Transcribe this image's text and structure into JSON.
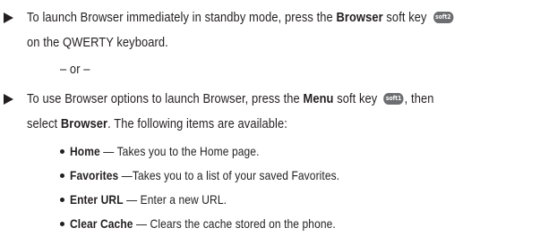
{
  "step1": {
    "text_before": "To launch Browser immediately in standby mode, press the ",
    "bold": "Browser",
    "text_after": " soft key ",
    "icon_label": "soft2",
    "line2": "on the QWERTY keyboard."
  },
  "or_text": "– or –",
  "step2": {
    "text_before": "To use Browser options to launch Browser, press the ",
    "bold": "Menu",
    "text_after": " soft key ",
    "icon_label": "soft1",
    "text_end": ", then",
    "line2_before": "select ",
    "line2_bold": "Browser",
    "line2_after": ".   The following items are available:"
  },
  "items": [
    {
      "name": "Home",
      "desc": " — Takes you to the Home page."
    },
    {
      "name": "Favorites",
      "desc": " —Takes you to a list of your saved Favorites."
    },
    {
      "name": "Enter URL",
      "desc": " — Enter a new URL."
    },
    {
      "name": "Clear Cache",
      "desc": "  — Clears the cache stored on the phone."
    }
  ]
}
